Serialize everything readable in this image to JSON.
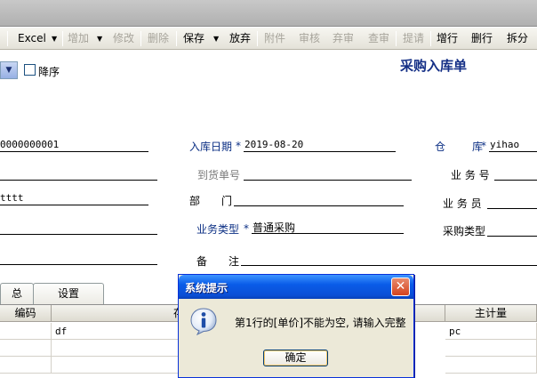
{
  "toolbar": {
    "items": [
      {
        "label": "Excel",
        "enabled": true
      },
      {
        "label": "增加",
        "enabled": false
      },
      {
        "label": "修改",
        "enabled": false
      },
      {
        "label": "删除",
        "enabled": false
      },
      {
        "label": "保存",
        "enabled": true
      },
      {
        "label": "放弃",
        "enabled": true
      },
      {
        "label": "附件",
        "enabled": false
      },
      {
        "label": "审核",
        "enabled": false
      },
      {
        "label": "弃审",
        "enabled": false
      },
      {
        "label": "查审",
        "enabled": false
      },
      {
        "label": "提请",
        "enabled": false
      },
      {
        "label": "增行",
        "enabled": true
      },
      {
        "label": "删行",
        "enabled": true
      },
      {
        "label": "拆分",
        "enabled": true
      }
    ]
  },
  "header": {
    "sort_desc_label": "降序",
    "form_title": "采购入库单"
  },
  "form": {
    "doc_no_value": "0000000001",
    "field4_value": "tttt",
    "in_date_label": "入库日期",
    "in_date_value": "2019-08-20",
    "warehouse_label": "仓　　库",
    "warehouse_value": "yihao",
    "arrival_no_label": "到货单号",
    "biz_no_label": "业 务 号",
    "dept_label": "部　　门",
    "staff_label": "业 务 员",
    "biz_type_label": "业务类型",
    "biz_type_value": "普通采购",
    "purchase_type_label": "采购类型",
    "remark_label": "备　　注",
    "required_mark": "*"
  },
  "tabs": {
    "tab1": "总",
    "tab2": "设置"
  },
  "grid": {
    "col1": "编码",
    "col2": "存货名称",
    "col3": "主计量",
    "row1": {
      "c2": "df",
      "c3": "pc"
    }
  },
  "dialog": {
    "title": "系统提示",
    "close_glyph": "✕",
    "message": "第1行的[单价]不能为空, 请输入完整",
    "ok_label": "确定",
    "icon": "info-icon"
  }
}
